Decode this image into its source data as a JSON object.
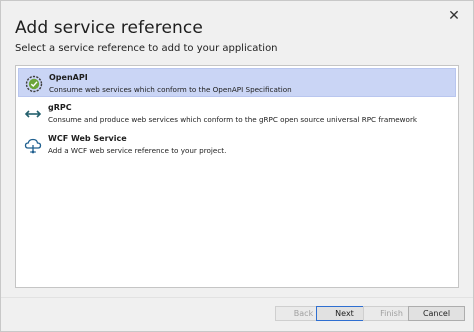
{
  "dialog": {
    "title": "Add service reference",
    "subtitle": "Select a service reference to add to your application",
    "close_glyph": "✕"
  },
  "services": [
    {
      "name": "OpenAPI",
      "description": "Consume web services which conform to the OpenAPI Specification",
      "icon": "openapi-icon",
      "selected": true
    },
    {
      "name": "gRPC",
      "description": "Consume and produce web services which conform to the gRPC open source universal RPC framework",
      "icon": "grpc-icon",
      "selected": false
    },
    {
      "name": "WCF Web Service",
      "description": "Add a WCF web service reference to your project.",
      "icon": "wcf-icon",
      "selected": false
    }
  ],
  "buttons": {
    "back": {
      "label": "Back",
      "enabled": false
    },
    "next": {
      "label": "Next",
      "enabled": true
    },
    "finish": {
      "label": "Finish",
      "enabled": false
    },
    "cancel": {
      "label": "Cancel",
      "enabled": true
    }
  },
  "colors": {
    "selection": "#cad5f5",
    "openapi_green": "#6ba539",
    "grpc_teal": "#24606d",
    "wcf_blue": "#1f5f8f"
  }
}
